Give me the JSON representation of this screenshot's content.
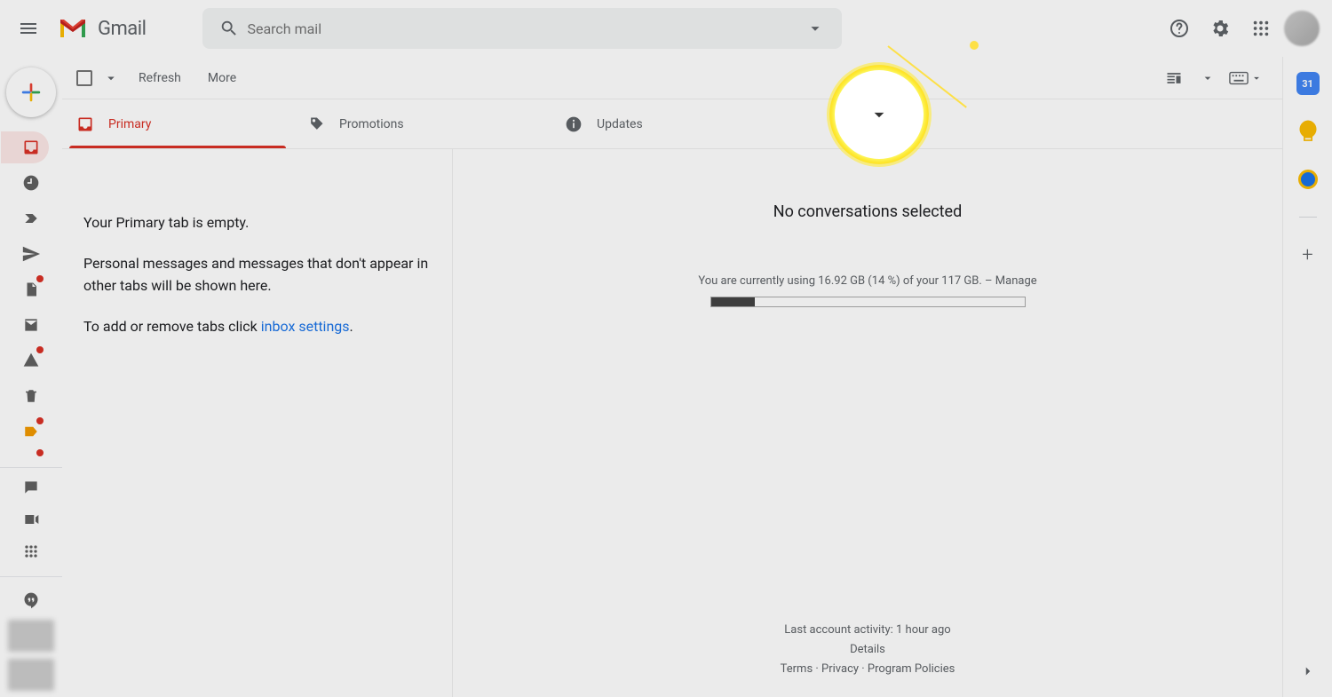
{
  "header": {
    "app_name": "Gmail",
    "search_placeholder": "Search mail"
  },
  "toolbar": {
    "refresh_label": "Refresh",
    "more_label": "More"
  },
  "tabs": {
    "primary": "Primary",
    "promotions": "Promotions",
    "updates": "Updates"
  },
  "sidebar_calendar_day": "31",
  "list_pane": {
    "empty_title": "Your Primary tab is empty.",
    "empty_body": "Personal messages and messages that don't appear in other tabs will be shown here.",
    "settings_prefix": "To add or remove tabs click ",
    "settings_link": "inbox settings",
    "settings_suffix": "."
  },
  "reading_pane": {
    "title": "No conversations selected",
    "storage_text": "You are currently using 16.92 GB (14 %) of your 117 GB. – ",
    "storage_manage": "Manage",
    "storage_percent": 14
  },
  "footer": {
    "activity": "Last account activity: 1 hour ago",
    "details": "Details",
    "terms": "Terms",
    "privacy": "Privacy",
    "policies": "Program Policies",
    "sep": " · "
  }
}
